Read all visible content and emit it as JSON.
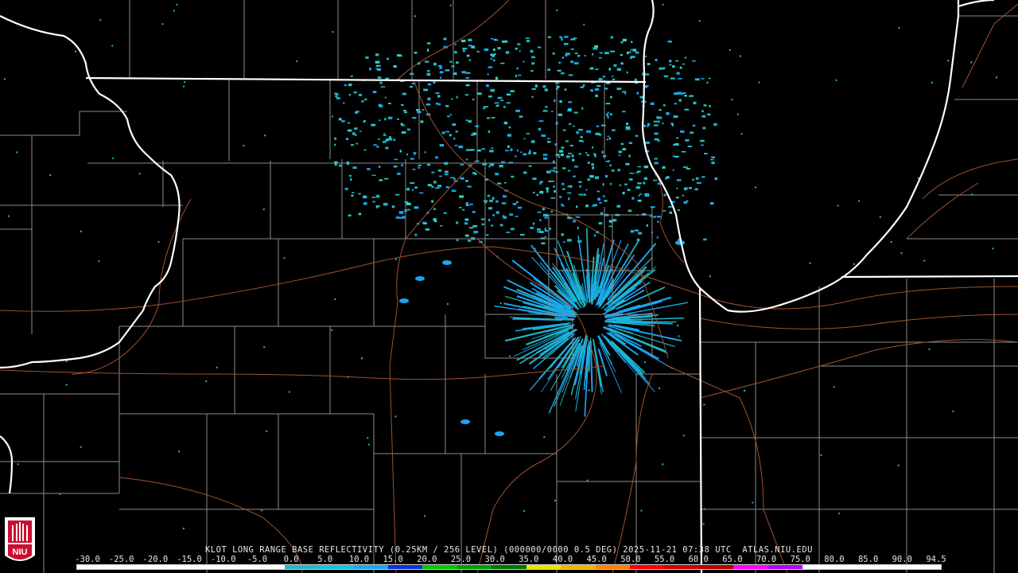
{
  "caption": "KLOT LONG RANGE BASE REFLECTIVITY (0.25KM / 256 LEVEL) (000000/0000 0.5 DEG) 2025-11-21 07:38 UTC  ATLAS.NIU.EDU",
  "scale": {
    "labels": [
      "-30.0",
      "-25.0",
      "-20.0",
      "-15.0",
      "-10.0",
      "-5.0",
      "0.0",
      "5.0",
      "10.0",
      "15.0",
      "20.0",
      "25.0",
      "30.0",
      "35.0",
      "40.0",
      "45.0",
      "50.0",
      "55.0",
      "60.0",
      "65.0",
      "70.0",
      "75.0",
      "80.0",
      "85.0",
      "90.0",
      "94.5"
    ],
    "colors": [
      "#ffffff",
      "#ffffff",
      "#ffffff",
      "#ffffff",
      "#ffffff",
      "#ffffff",
      "#1fb8c6",
      "#14c4d8",
      "#19a6f0",
      "#0a32d6",
      "#00c800",
      "#00a000",
      "#007800",
      "#e6e600",
      "#f0b400",
      "#ff8000",
      "#ff0000",
      "#d20000",
      "#b40000",
      "#ff00ff",
      "#b400ff",
      "#ffffff",
      "#ffffff",
      "#ffffff",
      "#ffffff"
    ]
  },
  "logo": {
    "text": "NIU"
  },
  "colors": {
    "background": "#000000",
    "state_border": "#ffffff",
    "county_border": "#8c8c8c",
    "highway": "#a0522d",
    "echo_light": "#1fb8c6",
    "echo_medium": "#19a6f0",
    "echo_strong": "#0a32d6"
  }
}
